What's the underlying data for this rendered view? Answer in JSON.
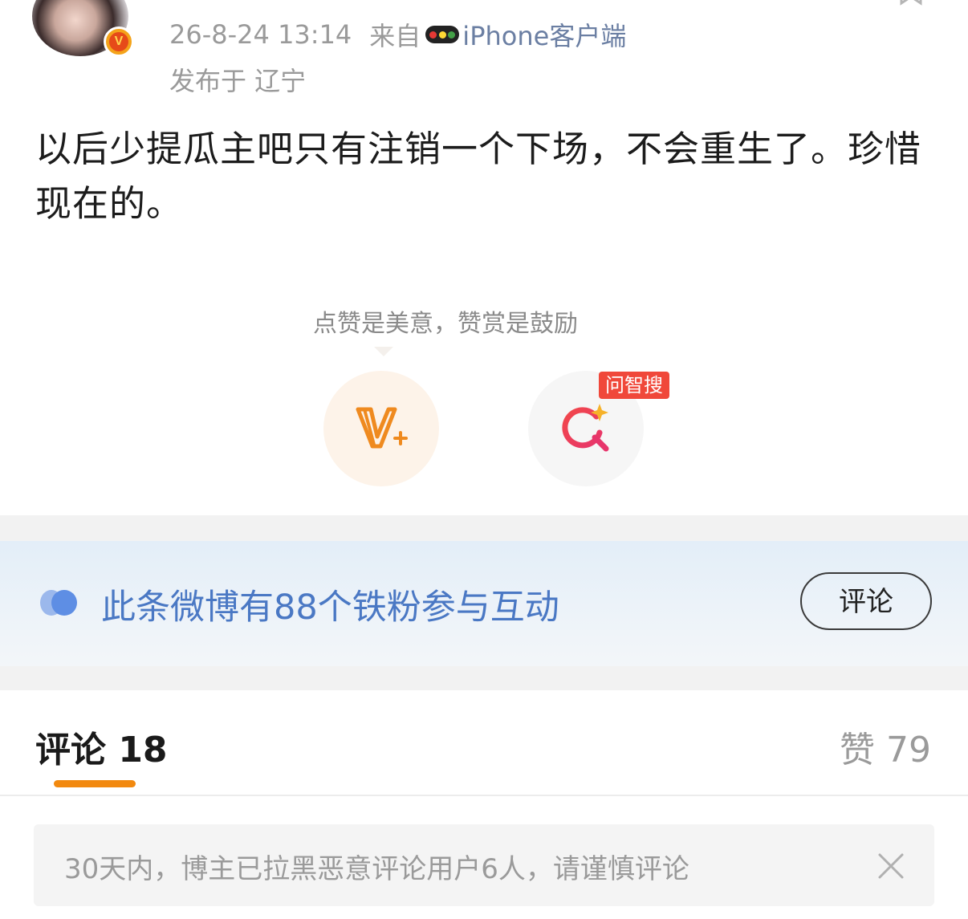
{
  "post": {
    "timestamp": "26-8-24 13:14",
    "source_prefix": "来自",
    "client": "iPhone客户端",
    "location": "发布于 辽宁",
    "verified_badge": "V",
    "text": "以后少提瓜主吧只有注销一个下场，不会重生了。珍惜现在的。"
  },
  "reward": {
    "tip": "点赞是美意，赞赏是鼓励",
    "search_badge": "问智搜",
    "icons": [
      "v-plus-icon",
      "ai-search-icon"
    ]
  },
  "fans_bar": {
    "text": "此条微博有88个铁粉参与互动",
    "comment_button": "评论"
  },
  "tabs": {
    "comments": "评论 18",
    "likes": "赞 79"
  },
  "notice": {
    "text": "30天内，博主已拉黑恶意评论用户6人，请谨慎评论"
  },
  "colors": {
    "accent_orange": "#f2890f",
    "link_blue": "#4a78c4",
    "badge_red": "#f0483a"
  }
}
